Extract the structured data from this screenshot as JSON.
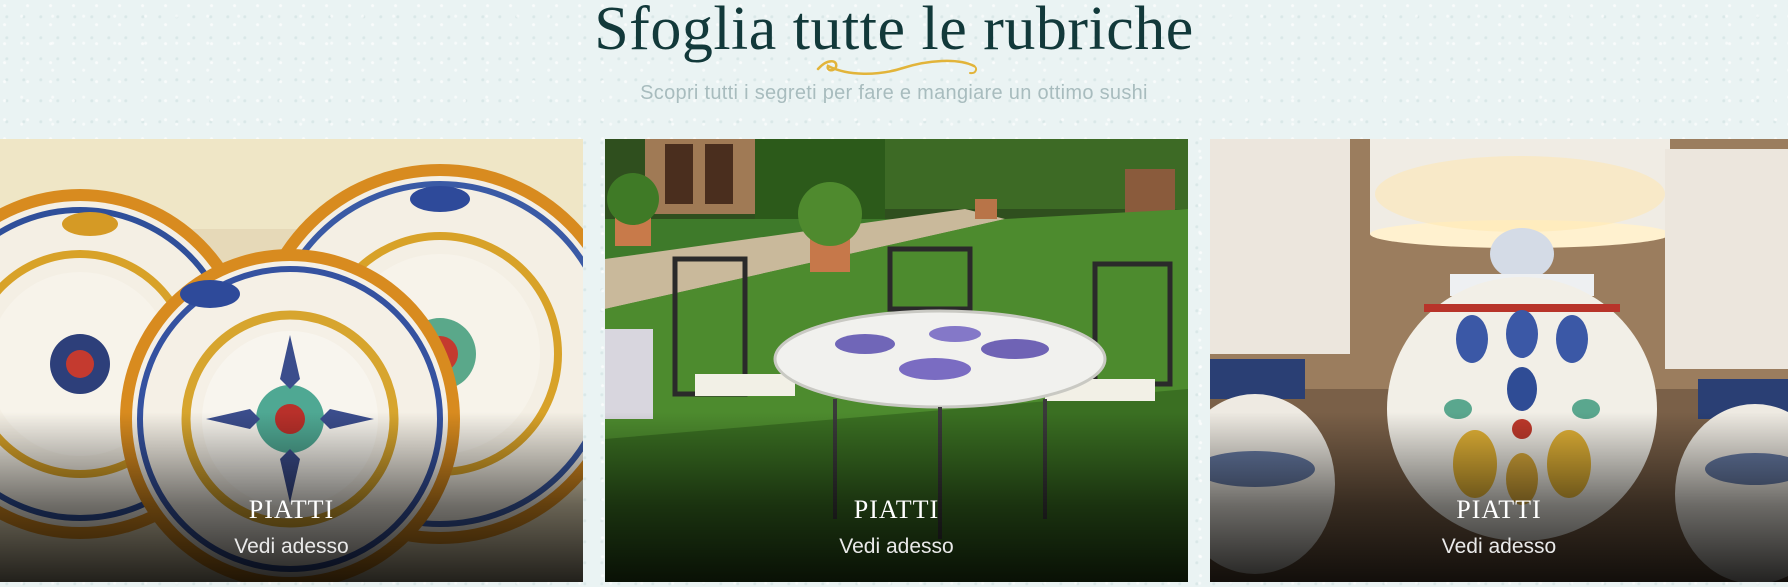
{
  "header": {
    "title": "Sfoglia tutte le rubriche",
    "subtitle": "Scopri tutti i segreti per fare e mangiare un ottimo sushi"
  },
  "colors": {
    "background": "#eaf3f3",
    "title": "#12393a",
    "subtitle": "#a8bcbe",
    "swirl": "#e2b43a"
  },
  "cards": [
    {
      "title": "PIATTI",
      "link": "Vedi adesso",
      "image": "decorated-ceramic-plates"
    },
    {
      "title": "PIATTI",
      "link": "Vedi adesso",
      "image": "garden-table-and-chairs"
    },
    {
      "title": "PIATTI",
      "link": "Vedi adesso",
      "image": "ceramic-lamps"
    }
  ]
}
